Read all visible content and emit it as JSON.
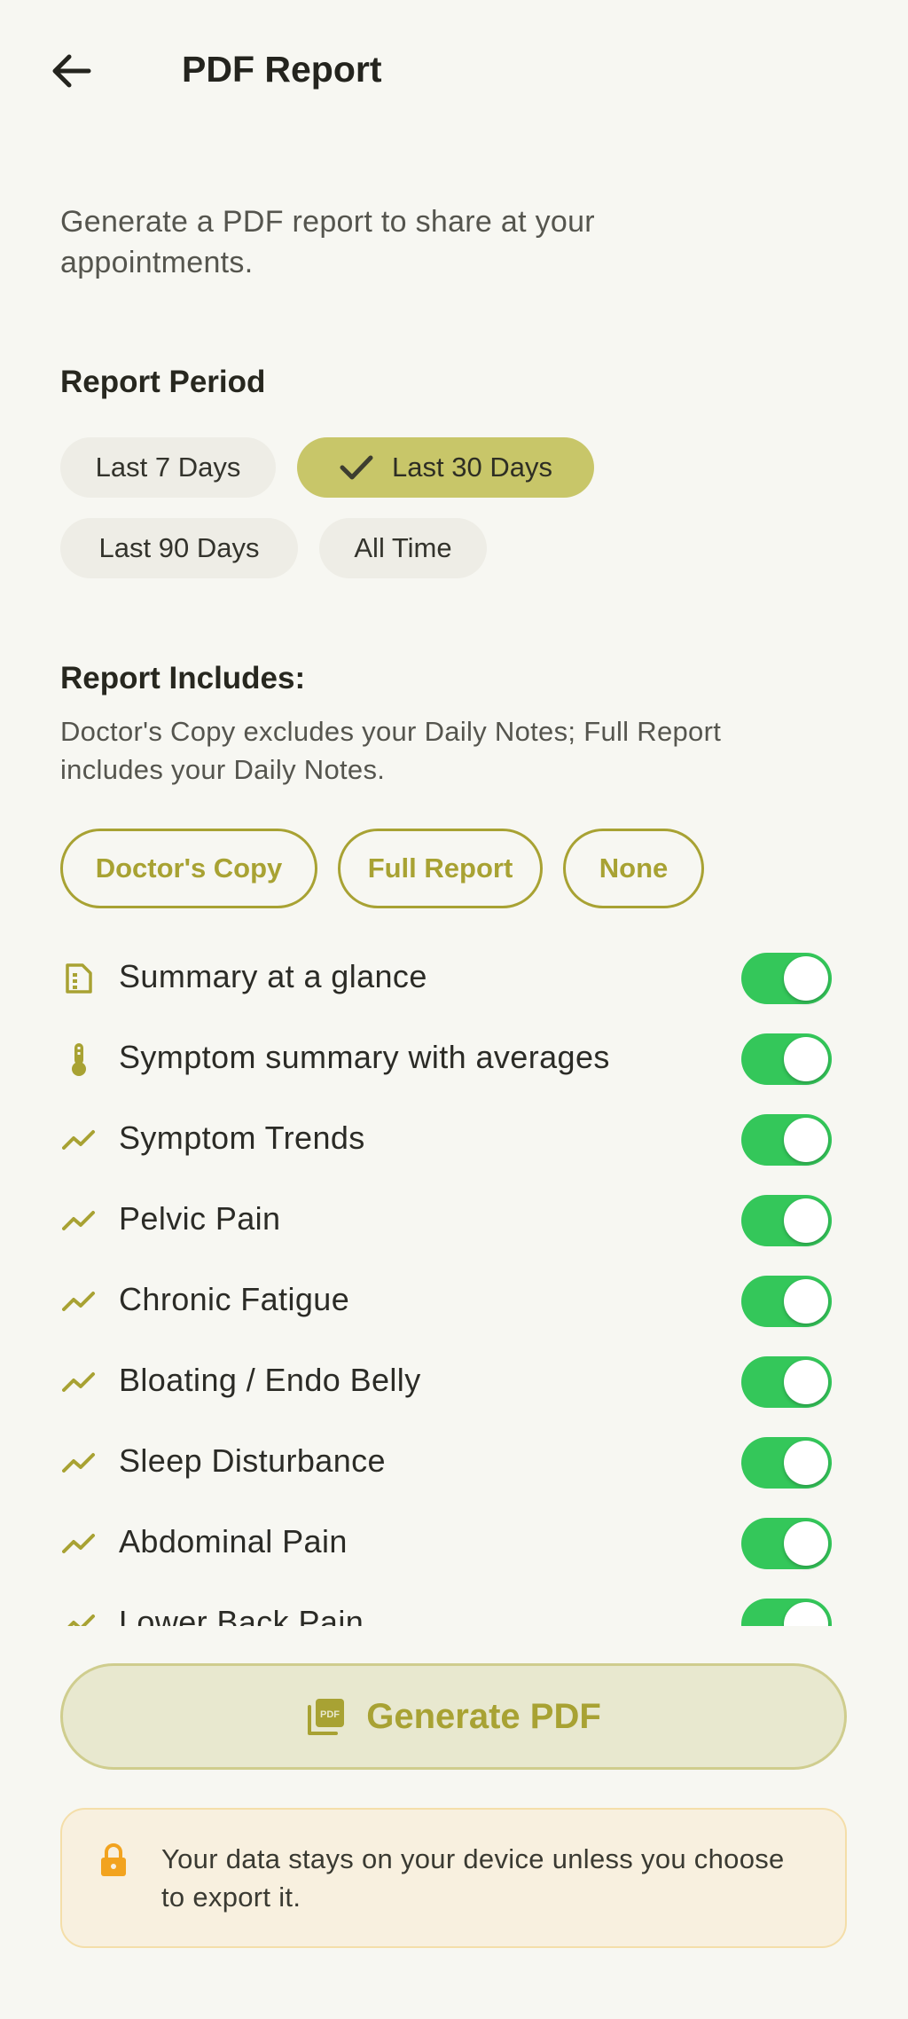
{
  "header": {
    "title": "PDF Report"
  },
  "intro": "Generate a PDF report to share at your appointments.",
  "report_period": {
    "title": "Report Period",
    "options": [
      "Last 7 Days",
      "Last 30 Days",
      "Last 90 Days",
      "All Time"
    ],
    "selected": "Last 30 Days"
  },
  "report_includes": {
    "title": "Report Includes:",
    "description": "Doctor's Copy excludes your Daily Notes; Full Report includes your Daily Notes.",
    "presets": [
      "Doctor's Copy",
      "Full Report",
      "None"
    ]
  },
  "items": [
    {
      "label": "Summary at a glance",
      "icon": "summary-document-icon",
      "enabled": true
    },
    {
      "label": "Symptom summary with averages",
      "icon": "thermometer-icon",
      "enabled": true
    },
    {
      "label": "Symptom Trends",
      "icon": "trend-line-icon",
      "enabled": true
    },
    {
      "label": "Pelvic Pain",
      "icon": "trend-line-icon",
      "enabled": true
    },
    {
      "label": "Chronic Fatigue",
      "icon": "trend-line-icon",
      "enabled": true
    },
    {
      "label": "Bloating / Endo Belly",
      "icon": "trend-line-icon",
      "enabled": true
    },
    {
      "label": "Sleep Disturbance",
      "icon": "trend-line-icon",
      "enabled": true
    },
    {
      "label": "Abdominal Pain",
      "icon": "trend-line-icon",
      "enabled": true
    },
    {
      "label": "Lower Back Pain",
      "icon": "trend-line-icon",
      "enabled": true
    }
  ],
  "generate": {
    "label": "Generate PDF",
    "icon": "pdf-file-icon"
  },
  "privacy": {
    "text": "Your data stays on your device unless you choose to export it.",
    "icon": "lock-icon"
  },
  "colors": {
    "background": "#f7f7f2",
    "accent": "#a8a233",
    "chip_selected": "#c8c669",
    "toggle_on": "#34c75a",
    "privacy_bg": "#f8f0df",
    "lock": "#f2a31f"
  }
}
